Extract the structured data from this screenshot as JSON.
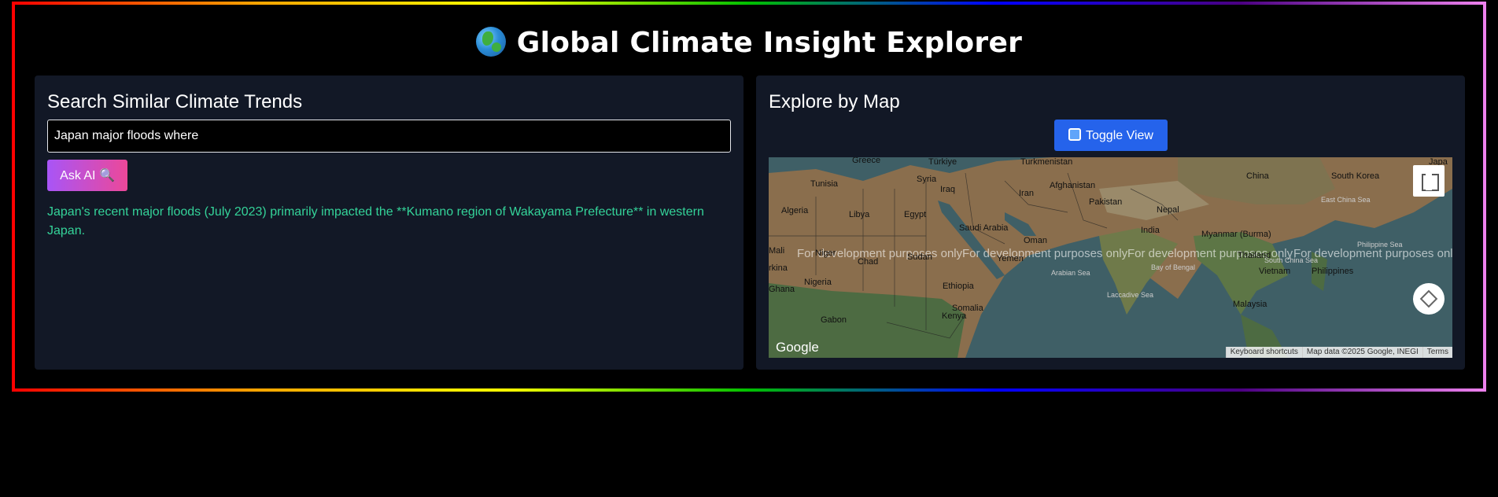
{
  "header": {
    "title": "Global Climate Insight Explorer",
    "icon": "globe-icon"
  },
  "search_panel": {
    "heading": "Search Similar Climate Trends",
    "input_value": "Japan major floods where",
    "ask_button_label": "Ask AI 🔍",
    "answer": "Japan's recent major floods (July 2023) primarily impacted the **Kumano region of Wakayama Prefecture** in western Japan."
  },
  "map_panel": {
    "heading": "Explore by Map",
    "toggle_label": "Toggle View",
    "dev_watermark": "For development purposes only",
    "google_logo": "Google",
    "attribution": [
      "Keyboard shortcuts",
      "Map data ©2025 Google, INEGI",
      "Terms"
    ],
    "places": [
      "Greece",
      "Türkiye",
      "Turkmenistan",
      "China",
      "South Korea",
      "East China Sea",
      "Tunisia",
      "Syria",
      "Iraq",
      "Afghanistan",
      "Iran",
      "Pakistan",
      "Nepal",
      "Algeria",
      "Libya",
      "Egypt",
      "Saudi Arabia",
      "India",
      "Myanmar (Burma)",
      "Philippine Sea",
      "Oman",
      "Mali",
      "Niger",
      "Chad",
      "Sudan",
      "Yemen",
      "Thailand",
      "South China Sea",
      "Vietnam",
      "Philippines",
      "Nigeria",
      "Ethiopia",
      "Bay of Bengal",
      "Arabian Sea",
      "Laccadive Sea",
      "Somalia",
      "Malaysia",
      "Ghana",
      "Kenya",
      "Gabon",
      "rkina",
      "Japa"
    ]
  }
}
